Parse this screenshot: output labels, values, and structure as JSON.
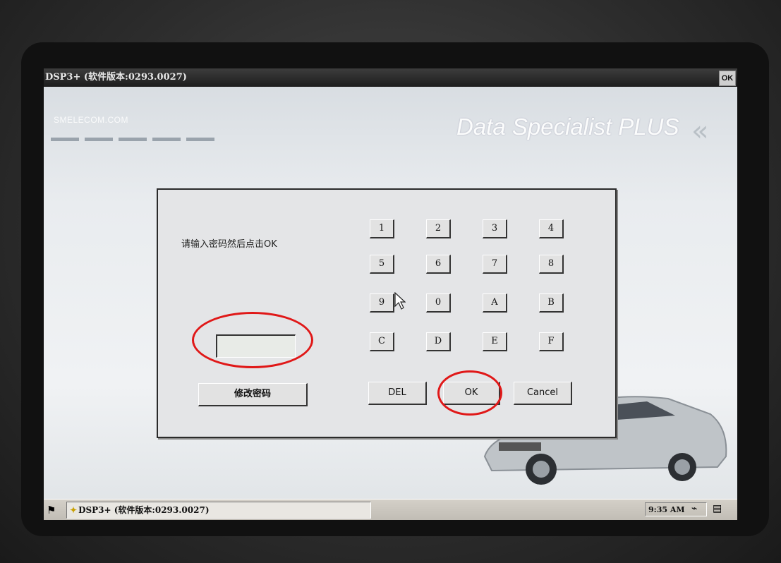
{
  "window": {
    "title": "DSP3+ (软件版本:0293.0027)",
    "ok_label": "OK"
  },
  "background": {
    "brand": "SMELECOM.COM",
    "product_title": "Data Specialist PLUS"
  },
  "dialog": {
    "prompt": "请输入密码然后点击OK",
    "password_value": "",
    "change_password_label": "修改密码",
    "keypad": [
      "1",
      "2",
      "3",
      "4",
      "5",
      "6",
      "7",
      "8",
      "9",
      "0",
      "A",
      "B",
      "C",
      "D",
      "E",
      "F"
    ],
    "del_label": "DEL",
    "ok_label": "OK",
    "cancel_label": "Cancel"
  },
  "taskbar": {
    "task_label": "DSP3+ (软件版本:0293.0027)",
    "clock": "9:35 AM"
  },
  "colors": {
    "annotation_ring": "#e01818",
    "title_bar": "#1d1d1d"
  },
  "icons": {
    "start": "windows-flag-icon",
    "task": "app-icon",
    "tray": [
      "network-icon",
      "keyboard-icon"
    ]
  }
}
